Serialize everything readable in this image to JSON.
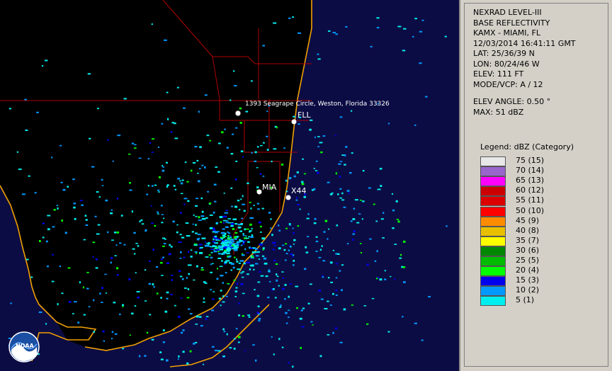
{
  "info": {
    "product": "NEXRAD LEVEL-III",
    "product_type": "BASE REFLECTIVITY",
    "station": "KAMX - MIAMI, FL",
    "datetime": "12/03/2014 16:41:11 GMT",
    "lat": "LAT: 25/36/39 N",
    "lon": "LON: 80/24/46 W",
    "elev": "ELEV: 111 FT",
    "mode": "MODE/VCP: A / 12",
    "elev_angle": "ELEV ANGLE: 0.50 °",
    "max": "MAX: 51 dBZ"
  },
  "legend": {
    "title": "Legend: dBZ (Category)",
    "items": [
      {
        "label": "75 (15)",
        "color": "#e8e8e8"
      },
      {
        "label": "70 (14)",
        "color": "#9966cc"
      },
      {
        "label": "65 (13)",
        "color": "#ff00ff"
      },
      {
        "label": "60 (12)",
        "color": "#cc0000"
      },
      {
        "label": "55 (11)",
        "color": "#dd0000"
      },
      {
        "label": "50 (10)",
        "color": "#ff0000"
      },
      {
        "label": "45 (9)",
        "color": "#ff8c00"
      },
      {
        "label": "40 (8)",
        "color": "#e8c000"
      },
      {
        "label": "35 (7)",
        "color": "#ffff00"
      },
      {
        "label": "30 (6)",
        "color": "#008800"
      },
      {
        "label": "25 (5)",
        "color": "#00bb00"
      },
      {
        "label": "20 (4)",
        "color": "#00ff00"
      },
      {
        "label": "15 (3)",
        "color": "#0000ee"
      },
      {
        "label": "10 (2)",
        "color": "#0099ff"
      },
      {
        "label": "5 (1)",
        "color": "#00eeee"
      }
    ]
  },
  "map": {
    "address_label": "1393 Seagrape Circle, Weston, Florida 33326",
    "cities": [
      {
        "name": "FLL"
      },
      {
        "name": "MIA"
      },
      {
        "name": "X44"
      }
    ]
  },
  "logo_text": "NOAA"
}
